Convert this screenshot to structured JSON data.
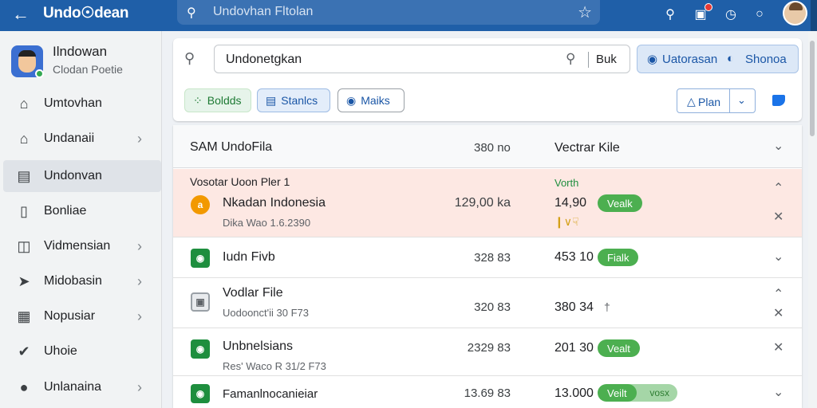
{
  "topbar": {
    "brand": "Undo☉dean",
    "search_text": "Undovhan Fltolan"
  },
  "sidebar": {
    "profile": {
      "name": "Ilndowan",
      "subtitle": "Clodan Poetie"
    },
    "items": [
      {
        "label": "Umtovhan",
        "icon": "home-icon",
        "chevron": false,
        "active": false
      },
      {
        "label": "Undanaii",
        "icon": "home-icon",
        "chevron": true,
        "active": false
      },
      {
        "label": "Undonvan",
        "icon": "list-icon",
        "chevron": false,
        "active": true
      },
      {
        "label": "Bonliae",
        "icon": "phone-icon",
        "chevron": false,
        "active": false
      },
      {
        "label": "Vidmensian",
        "icon": "layers-icon",
        "chevron": true,
        "active": false
      },
      {
        "label": "Midobasin",
        "icon": "tag-icon",
        "chevron": true,
        "active": false
      },
      {
        "label": "Nopusiar",
        "icon": "grid-icon",
        "chevron": true,
        "active": false
      },
      {
        "label": "Uhoie",
        "icon": "pin-icon",
        "chevron": false,
        "active": false
      },
      {
        "label": "Unlanaina",
        "icon": "info-icon",
        "chevron": true,
        "active": false
      }
    ]
  },
  "toolbar": {
    "search_value": "Undonetgkan",
    "search_scope": "Buk",
    "share_label_1": "Uatorasan",
    "share_label_2": "Shonoa",
    "chips": [
      "Boldds",
      "Stanlcs",
      "Maiks"
    ],
    "plan_label": "Plan"
  },
  "list": {
    "header": {
      "name": "SAM UndoFila",
      "size": "380 no",
      "value": "Vectrar Kile"
    },
    "rows": [
      {
        "topline": "Vosotar Uoon Pler 1",
        "value_label": "Vorth",
        "name": "Nkadan Indonesia",
        "meta": "Dika Wao 1.6.2390",
        "size": "129,00 ka",
        "value": "14,90",
        "pill": "Vealk",
        "expanded": true
      },
      {
        "name": "Iudn Fivb",
        "size": "328 83",
        "value": "453 10",
        "pill": "Fialk"
      },
      {
        "name": "Vodlar File",
        "meta": "Uodoonct'ii 30 F73",
        "size": "320 83",
        "value": "380 34"
      },
      {
        "name": "Unbnelsians",
        "meta": "Res' Waco R 31/2 F73",
        "size": "2329 83",
        "value": "201 30",
        "pill": "Vealt"
      },
      {
        "name": "Famanlnocanieiar",
        "size": "13.69 83",
        "value": "13.000",
        "pill": "Veilt",
        "pill2": "vosx"
      }
    ]
  }
}
